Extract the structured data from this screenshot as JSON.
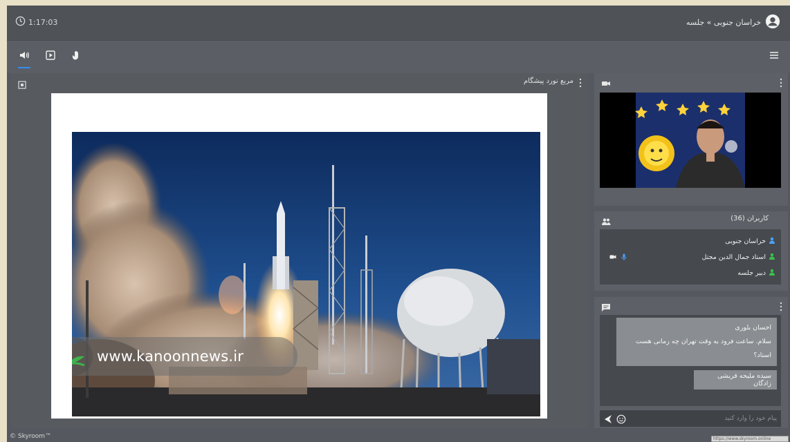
{
  "header": {
    "elapsed_time": "1:17:03",
    "breadcrumb": "خراسان جنوبی » جلسه"
  },
  "toolbar": {
    "audio_icon": "speaker-icon",
    "screen_icon": "play-square-icon",
    "hand_icon": "raise-hand-icon",
    "menu_icon": "hamburger-icon",
    "accent_color": "#2f8ff0"
  },
  "presentation": {
    "title": "مربع نورد پیشگام",
    "watermark_url": "www.kanoonnews.ir"
  },
  "users_panel": {
    "title": "کاربران (36)",
    "users": [
      {
        "name": "خراسان جنوبی",
        "color": "#4aa3ff"
      },
      {
        "name": "استاد جمال الدین مجتل",
        "color": "#39c24a"
      },
      {
        "name": "دبیر جلسه",
        "color": "#39c24a"
      }
    ]
  },
  "chat_panel": {
    "messages": [
      {
        "author": "احسان بلوری",
        "text": "سلام. ساعت فرود به وقت تهران چه زمانی هست استاد؟"
      },
      {
        "author": "",
        "text": "سیده ملیحه قریشی زادگان"
      }
    ],
    "placeholder": "پیام خود را وارد کنید"
  },
  "footer": {
    "brand": "© Skyroom™",
    "status_url": "https://www.skyroom.online"
  }
}
